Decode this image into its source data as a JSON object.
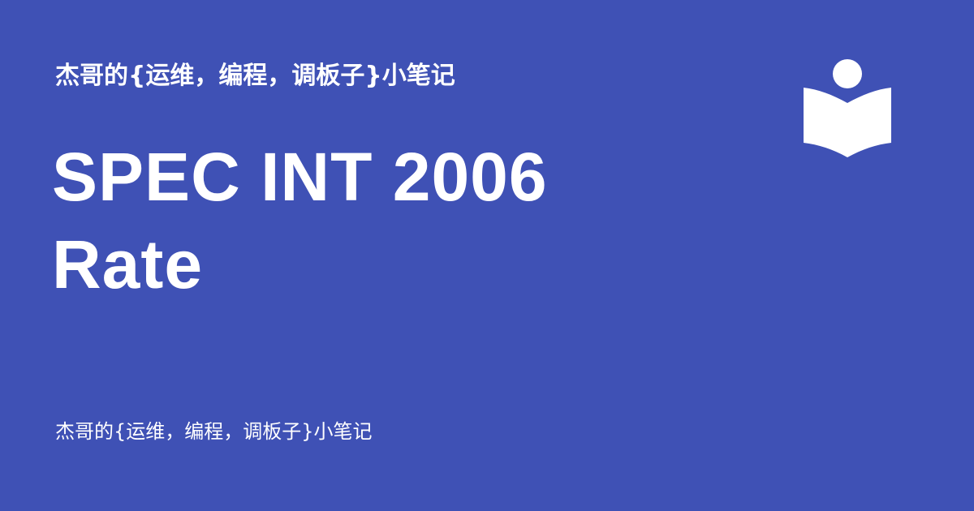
{
  "header": {
    "site_name": "杰哥的{运维，编程，调板子}小笔记"
  },
  "main": {
    "title_line_1": "SPEC INT 2006",
    "title_line_2": "Rate"
  },
  "footer": {
    "site_name": "杰哥的{运维，编程，调板子}小笔记"
  },
  "logo": {
    "icon": "reader-book-icon"
  },
  "colors": {
    "background": "#3f51b5",
    "text": "#ffffff"
  }
}
